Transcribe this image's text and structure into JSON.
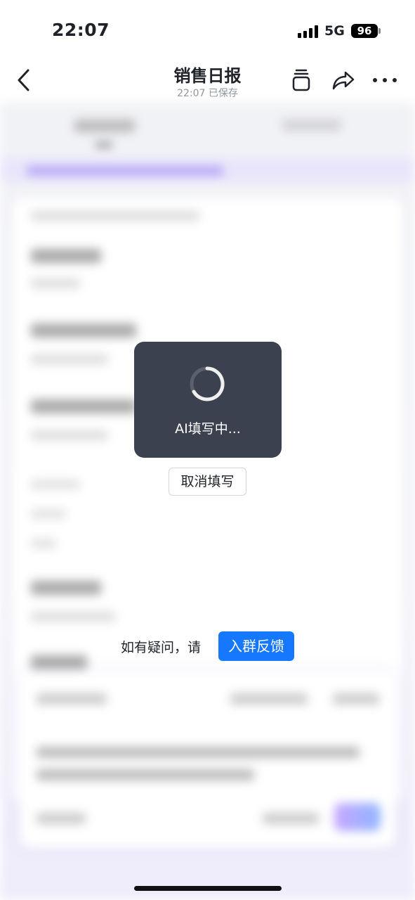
{
  "status_bar": {
    "time": "22:07",
    "network": "5G",
    "battery": "96"
  },
  "nav": {
    "title": "销售日报",
    "subtitle": "22:07 已保存"
  },
  "loading": {
    "text": "AI填写中..."
  },
  "actions": {
    "cancel_label": "取消填写",
    "question_text": "如有疑问，请",
    "join_label": "入群反馈"
  },
  "colors": {
    "accent": "#1677ff",
    "toast_bg": "#3b414f"
  },
  "icons": {
    "back": "chevron-left-icon",
    "copy": "copy-icon",
    "share": "share-icon",
    "more": "more-icon",
    "spinner": "spinner-icon"
  }
}
